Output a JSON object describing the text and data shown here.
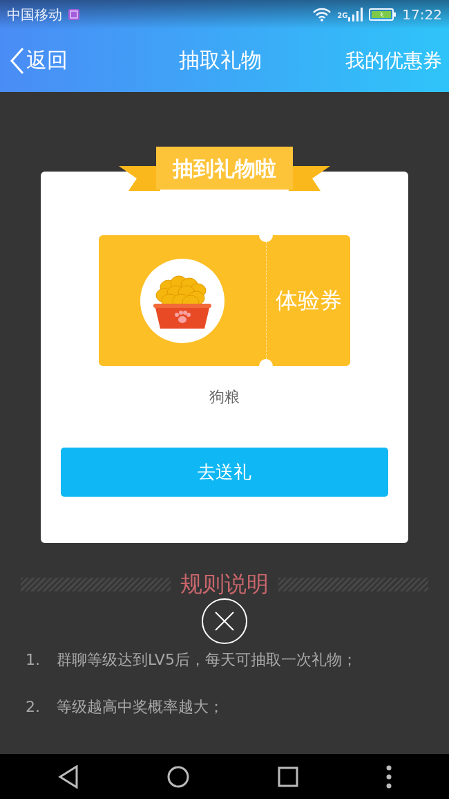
{
  "status_bar": {
    "carrier": "中国移动",
    "network": "2G",
    "time": "17:22"
  },
  "nav": {
    "back_label": "返回",
    "title": "抽取礼物",
    "right_action": "我的优惠券"
  },
  "rules": {
    "title": "规则说明",
    "items": [
      {
        "number": "1.",
        "text": "群聊等级达到LV5后，每天可抽取一次礼物；"
      },
      {
        "number": "2.",
        "text": "等级越高中奖概率越大；"
      }
    ]
  },
  "dialog": {
    "ribbon_title": "抽到礼物啦",
    "ticket": {
      "label": "体验券"
    },
    "gift_name": "狗粮",
    "button": "去送礼"
  }
}
